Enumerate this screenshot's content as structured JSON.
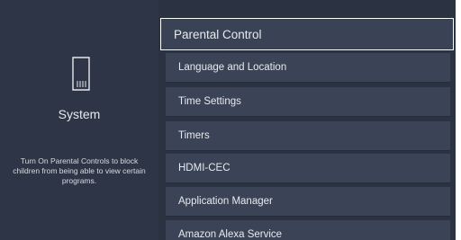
{
  "left_panel": {
    "icon": "sd-card-icon",
    "title": "System",
    "description": "Turn On Parental Controls to block children from being able to view certain programs."
  },
  "menu": {
    "items": [
      {
        "label": "Parental Control",
        "selected": true
      },
      {
        "label": "Language and Location"
      },
      {
        "label": "Time Settings"
      },
      {
        "label": "Timers"
      },
      {
        "label": "HDMI-CEC"
      },
      {
        "label": "Application Manager"
      },
      {
        "label": "Amazon Alexa Service"
      }
    ]
  }
}
